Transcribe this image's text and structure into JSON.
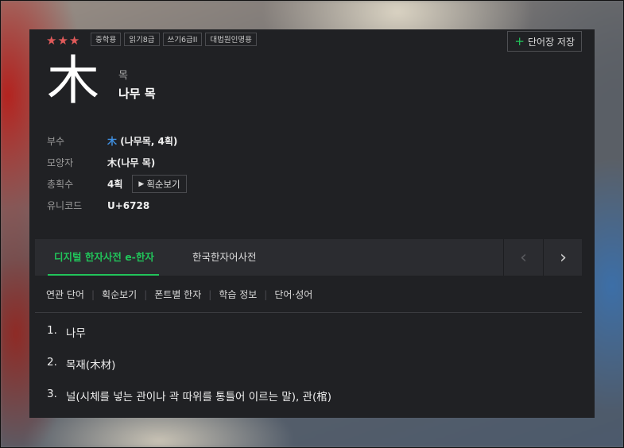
{
  "header": {
    "stars": "★★★",
    "tags": [
      "중학용",
      "읽기8급",
      "쓰기6급II",
      "대법원인명용"
    ],
    "save_button": "단어장 저장",
    "save_icon": "+"
  },
  "character": {
    "hanja": "木",
    "sound": "목",
    "meaning": "나무 목"
  },
  "info": {
    "radical_label": "부수",
    "radical_char": "木",
    "radical_detail": "(나무목, 4획)",
    "shape_label": "모양자",
    "shape_value": "木(나무 목)",
    "strokes_label": "총획수",
    "strokes_value": "4획",
    "stroke_order_button": "획순보기",
    "stroke_order_icon": "▶",
    "unicode_label": "유니코드",
    "unicode_value": "U+6728"
  },
  "tabs": {
    "active": "디지털 한자사전 e-한자",
    "other": "한국한자어사전",
    "prev_icon": "‹",
    "next_icon": "›"
  },
  "subnav": [
    "연관 단어",
    "획순보기",
    "폰트별 한자",
    "학습 정보",
    "단어·성어"
  ],
  "definitions": [
    {
      "num": "1.",
      "text": "나무"
    },
    {
      "num": "2.",
      "text": "목재(木材)"
    },
    {
      "num": "3.",
      "text": "널(시체를 넣는 관이나 곽 따위를 통틀어 이르는 말), 관(棺)"
    }
  ],
  "colors": {
    "accent": "#21c45a",
    "stars": "#e05a5a",
    "radical_link": "#3f8fe0",
    "panel_bg": "#202124"
  }
}
